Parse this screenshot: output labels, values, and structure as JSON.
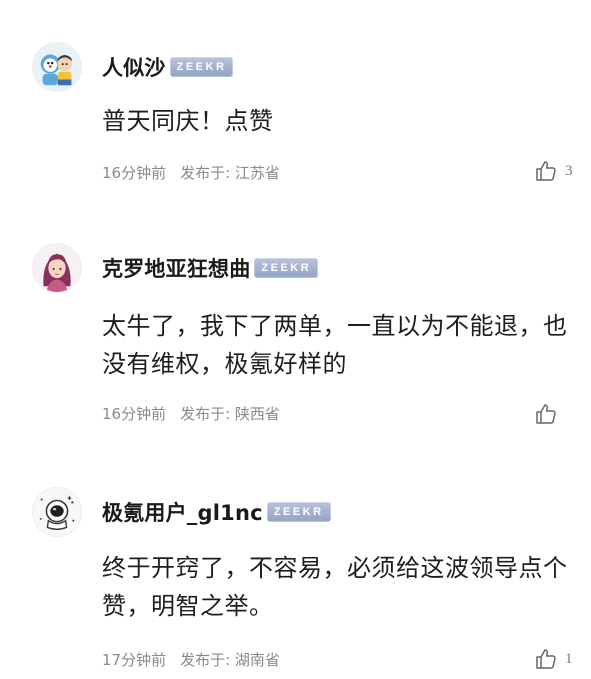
{
  "comments": [
    {
      "username": "人似沙",
      "badge": "ZEEKR",
      "content": "普天同庆！点赞",
      "time": "16分钟前",
      "location": "发布于: 江苏省",
      "likes": "3",
      "avatar_icon": "cartoon-couple-avatar-icon"
    },
    {
      "username": "克罗地亚狂想曲",
      "badge": "ZEEKR",
      "content": "太牛了，我下了两单，一直以为不能退，也没有维权，极氪好样的",
      "time": "16分钟前",
      "location": "发布于: 陕西省",
      "likes": "",
      "avatar_icon": "purple-hair-girl-avatar-icon"
    },
    {
      "username": "极氪用户_gl1nc",
      "badge": "ZEEKR",
      "content": "终于开窍了，不容易，必须给这波领导点个赞，明智之举。",
      "time": "17分钟前",
      "location": "发布于: 湖南省",
      "likes": "1",
      "avatar_icon": "astronaut-avatar-icon"
    }
  ],
  "colors": {
    "text": "#1e1e1e",
    "meta": "#8a8a8a",
    "badge_start": "#b8c4dc",
    "badge_end": "#93a2c4"
  }
}
